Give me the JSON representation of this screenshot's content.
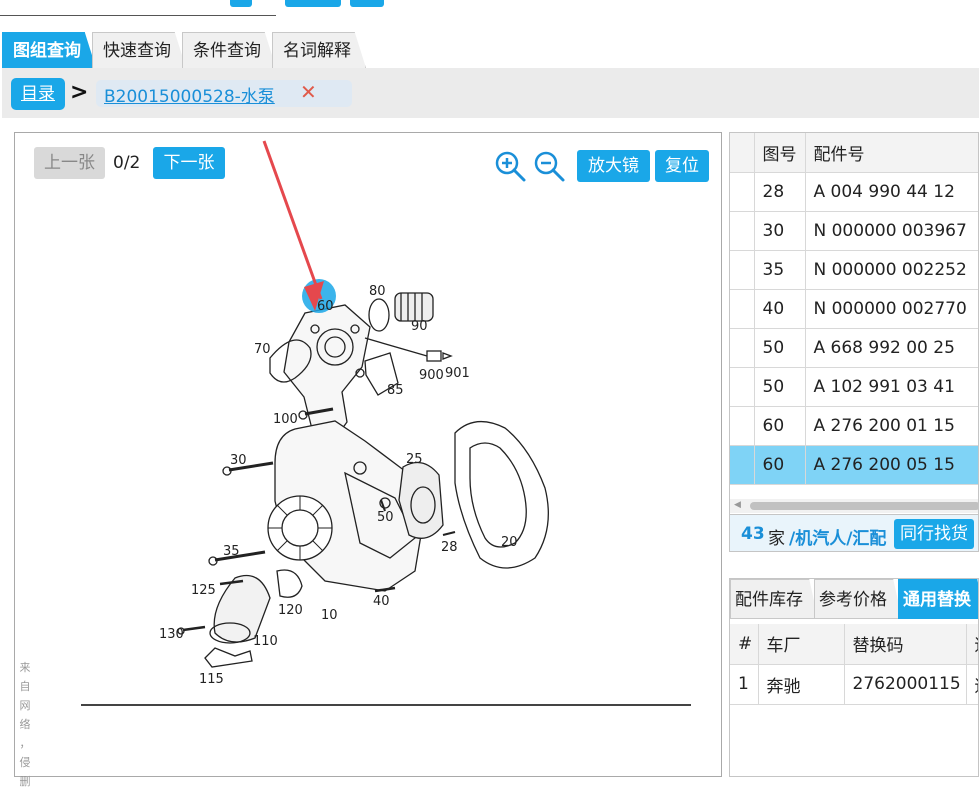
{
  "tabs": [
    {
      "label": "图组查询",
      "active": true
    },
    {
      "label": "快速查询",
      "active": false
    },
    {
      "label": "条件查询",
      "active": false
    },
    {
      "label": "名词解释",
      "active": false
    }
  ],
  "breadcrumb": {
    "root": "目录",
    "separator": ">",
    "current": "B20015000528-水泵",
    "close": "✕"
  },
  "viewer": {
    "prev_label": "上一张",
    "page": "0/2",
    "next_label": "下一张",
    "magnifier_label": "放大镜",
    "reset_label": "复位",
    "watermark": [
      "来",
      "自",
      "网",
      "络",
      "，",
      "侵",
      "删"
    ],
    "callouts": {
      "c60": "60",
      "c80": "80",
      "c90": "90",
      "c70": "70",
      "c900": "900",
      "c901": "901",
      "c85": "85",
      "c100": "100",
      "c30": "30",
      "c25": "25",
      "c50": "50",
      "c28": "28",
      "c20": "20",
      "c35": "35",
      "c125": "125",
      "c120": "120",
      "c10": "10",
      "c40": "40",
      "c130": "130",
      "c110": "110",
      "c115": "115"
    }
  },
  "parts_table": {
    "headers": [
      "图号",
      "配件号"
    ],
    "rows": [
      {
        "fig": "28",
        "part": "A 004 990 44 12",
        "selected": false
      },
      {
        "fig": "30",
        "part": "N 000000 003967",
        "selected": false
      },
      {
        "fig": "35",
        "part": "N 000000 002252",
        "selected": false
      },
      {
        "fig": "40",
        "part": "N 000000 002770",
        "selected": false
      },
      {
        "fig": "50",
        "part": "A 668 992 00 25",
        "selected": false
      },
      {
        "fig": "50",
        "part": "A 102 991 03 41",
        "selected": false
      },
      {
        "fig": "60",
        "part": "A 276 200 01 15",
        "selected": false
      },
      {
        "fig": "60",
        "part": "A 276 200 05 15",
        "selected": true
      }
    ],
    "footer": {
      "count": "43",
      "unit": "家",
      "source": "/机汽人/汇配",
      "button": "同行找货"
    }
  },
  "bottom_panel": {
    "tabs": [
      {
        "label": "配件库存",
        "active": false
      },
      {
        "label": "参考价格",
        "active": false
      },
      {
        "label": "通用替换",
        "active": true
      }
    ],
    "headers": [
      "#",
      "车厂",
      "替换码",
      "适"
    ],
    "rows": [
      {
        "idx": "1",
        "maker": "奔驰",
        "code": "2762000115",
        "extra": "适"
      }
    ]
  },
  "colors": {
    "accent": "#1aa7e8",
    "selected_row": "#7fd3f6",
    "arrow": "#e5484d",
    "close": "#e05a4a"
  }
}
